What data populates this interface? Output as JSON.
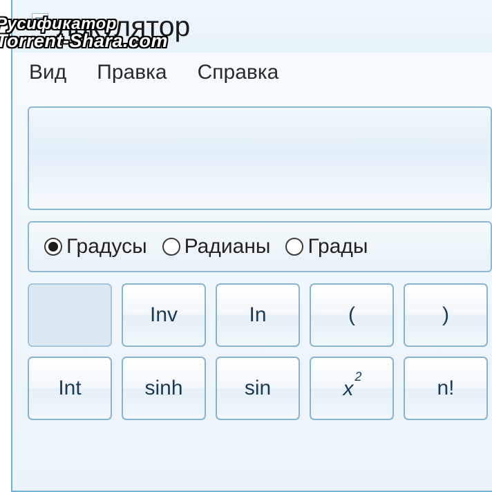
{
  "title": "лькулятор",
  "watermark": {
    "line1": "Русификатор",
    "line2": "Torrent-Shara.com"
  },
  "menu": {
    "view": "Вид",
    "edit": "Правка",
    "help": "Справка"
  },
  "display": {
    "value": ""
  },
  "angle": {
    "degrees": {
      "label": "Градусы",
      "selected": true
    },
    "radians": {
      "label": "Радианы",
      "selected": false
    },
    "grads": {
      "label": "Грады",
      "selected": false
    }
  },
  "keys": {
    "row1": {
      "c0": "",
      "c1": "Inv",
      "c2": "In",
      "c3": "(",
      "c4": ")"
    },
    "row2": {
      "c0": "Int",
      "c1": "sinh",
      "c2": "sin",
      "c3_base": "x",
      "c3_exp": "2",
      "c4": "n!"
    }
  }
}
